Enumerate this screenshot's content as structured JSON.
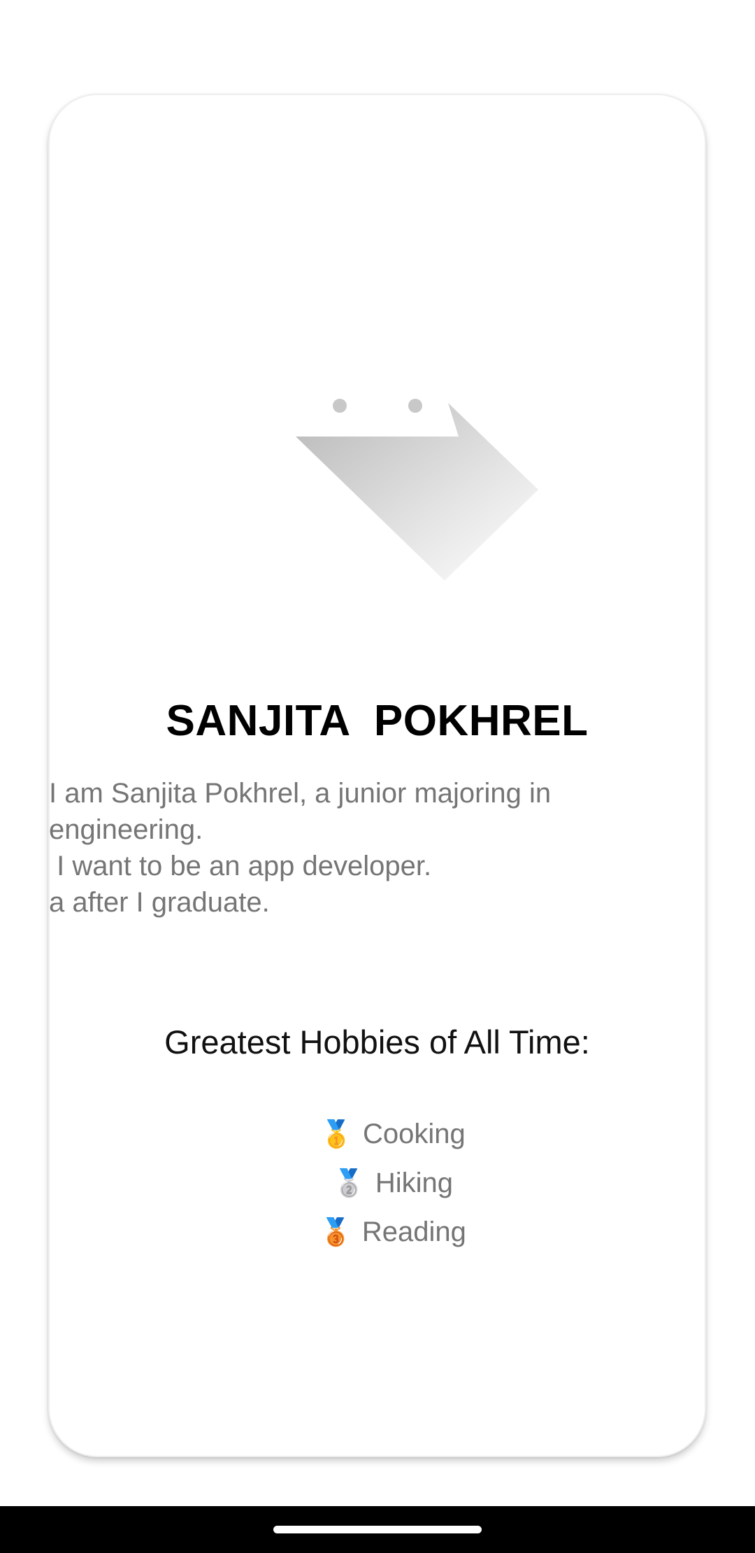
{
  "profile": {
    "name": "SANJITA  POKHREL",
    "bio_lines": [
      "I am Sanjita Pokhrel, a junior majoring in",
      "engineering.",
      " I want to be an app developer.",
      "a after I graduate."
    ]
  },
  "hobbies": {
    "title": "Greatest Hobbies of All Time:",
    "items": [
      {
        "medal": "🥇",
        "label": "Cooking",
        "icon": "gold-medal-icon"
      },
      {
        "medal": "🥈",
        "label": "Hiking",
        "icon": "silver-medal-icon"
      },
      {
        "medal": "🥉",
        "label": "Reading",
        "icon": "bronze-medal-icon"
      }
    ]
  },
  "colors": {
    "name": "#000000",
    "bio": "#757575",
    "nav_bar": "#000000"
  }
}
